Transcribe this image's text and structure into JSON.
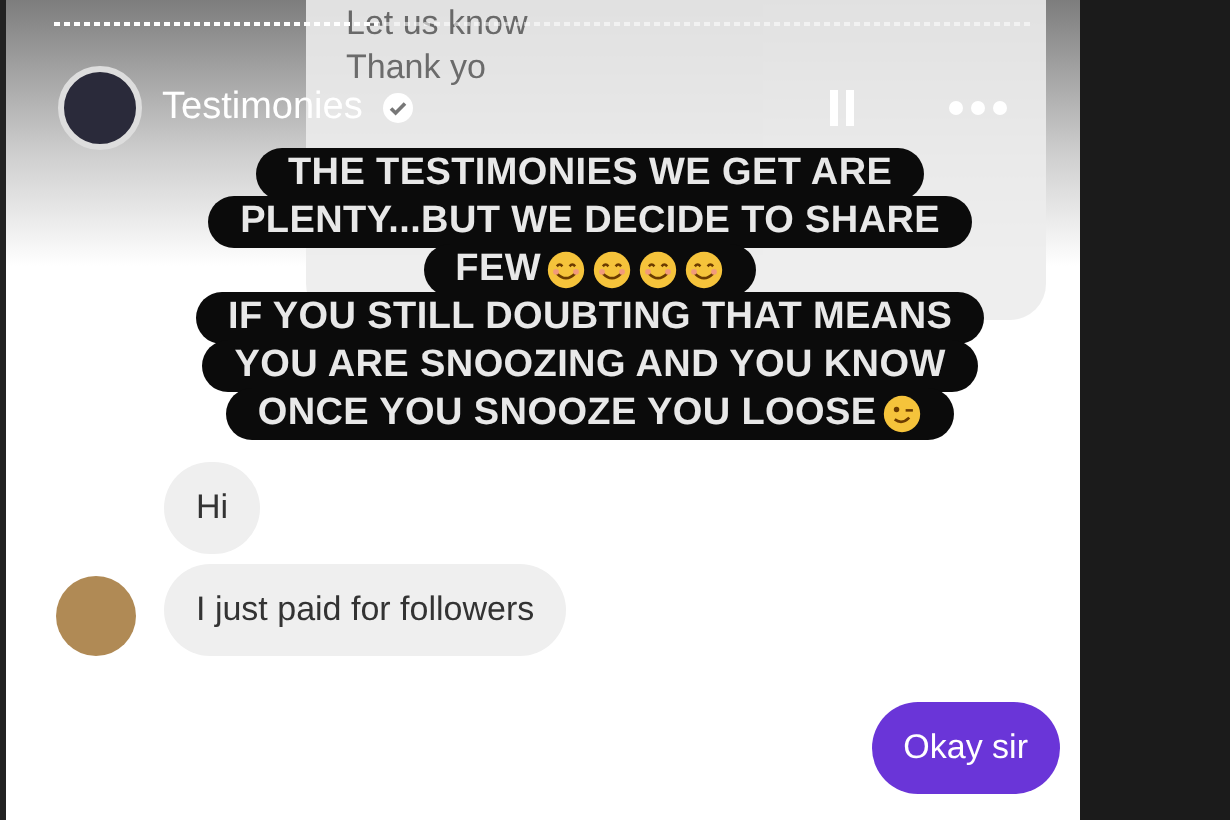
{
  "story": {
    "account": "Testimonies",
    "verified": true,
    "progress": {
      "level": 0.33
    }
  },
  "background_message": {
    "lines": [
      "Let us know",
      "Thank yo"
    ]
  },
  "caption": {
    "lines": [
      {
        "text": "THE TESTIMONIES WE GET ARE",
        "kind": "plain"
      },
      {
        "text": "PLENTY...BUT WE DECIDE TO SHARE",
        "kind": "plain"
      },
      {
        "text": "FEW",
        "kind": "smiles"
      },
      {
        "text": "IF YOU STILL DOUBTING THAT MEANS",
        "kind": "plain"
      },
      {
        "text": "YOU ARE SNOOZING AND YOU KNOW",
        "kind": "plain"
      },
      {
        "text": "ONCE YOU SNOOZE YOU LOOSE",
        "kind": "wink"
      }
    ]
  },
  "messages": [
    {
      "text": "Hi",
      "kind": "received"
    },
    {
      "text": "I just paid for followers",
      "kind": "received",
      "avatar": true
    },
    {
      "text": "Okay sir",
      "kind": "sent"
    }
  ]
}
